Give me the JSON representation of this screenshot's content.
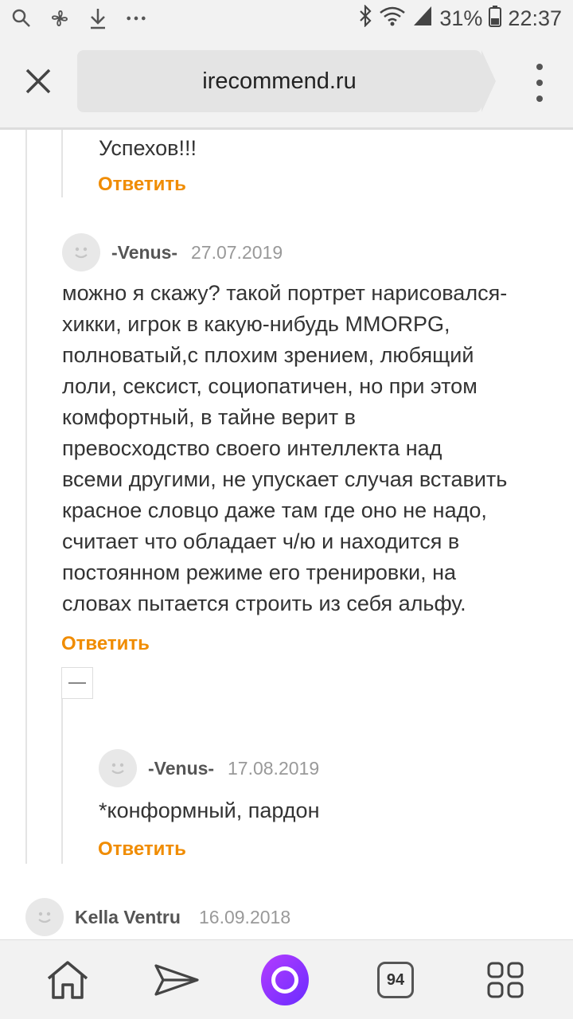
{
  "status_bar": {
    "battery_percent": "31%",
    "time": "22:37"
  },
  "browser": {
    "url": "irecommend.ru",
    "tabs_count": "94"
  },
  "comments": {
    "prev_text": "Успехов!!!",
    "reply_label": "Ответить",
    "c1": {
      "author": "-Venus-",
      "date": "27.07.2019",
      "lines": [
        "можно я скажу? такой портрет нарисовался-",
        "хикки, игрок в какую-нибудь MMORPG,",
        "полноватый,с плохим зрением, любящий",
        "лоли, сексист, социопатичен, но при этом",
        "комфортный, в тайне верит в",
        "превосходство своего интеллекта над",
        "всеми другими, не упускает случая вставить",
        "красное словцо даже там где оно не надо,",
        "считает что обладает ч/ю и находится в",
        "постоянном режиме его тренировки, на",
        "словах пытается строить из себя альфу."
      ]
    },
    "c2": {
      "author": "-Venus-",
      "date": "17.08.2019",
      "text": "*конформный, пардон"
    },
    "c3": {
      "author": "Kella Ventru",
      "date": "16.09.2018"
    }
  }
}
